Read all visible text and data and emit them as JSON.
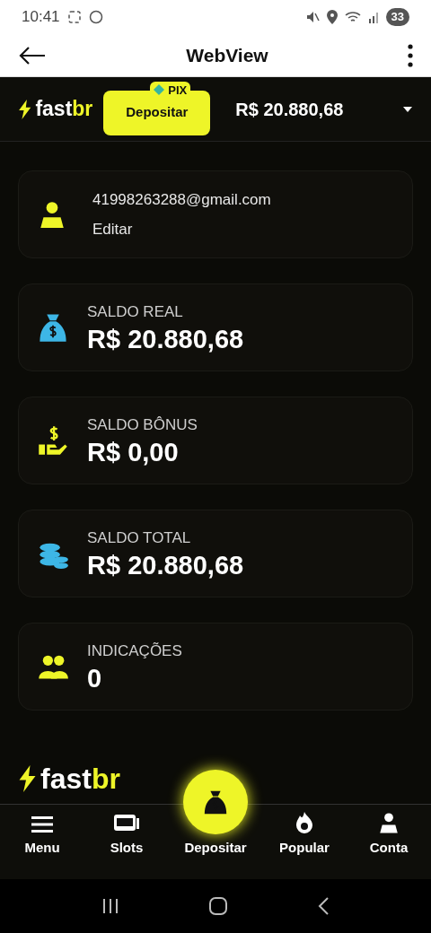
{
  "status_bar": {
    "time": "10:41",
    "battery": "33"
  },
  "app_bar": {
    "title": "WebView"
  },
  "header": {
    "logo": {
      "main": "fast",
      "accent": "br"
    },
    "deposit_button": "Depositar",
    "badge": "PIX",
    "balance": "R$ 20.880,68"
  },
  "cards": [
    {
      "kind": "profile",
      "email": "41998263288@gmail.com",
      "link": "Editar"
    },
    {
      "kind": "balance",
      "label": "SALDO REAL",
      "value": "R$ 20.880,68"
    },
    {
      "kind": "balance",
      "label": "SALDO BÔNUS",
      "value": "R$ 0,00"
    },
    {
      "kind": "balance",
      "label": "SALDO TOTAL",
      "value": "R$ 20.880,68"
    },
    {
      "kind": "balance",
      "label": "INDICAÇÕES",
      "value": "0"
    }
  ],
  "footer_logo": {
    "main": "fast",
    "accent": "br"
  },
  "bottom_nav": [
    {
      "kind": "tab",
      "label": "Menu"
    },
    {
      "kind": "tab",
      "label": "Slots"
    },
    {
      "kind": "fab",
      "label": "Depositar"
    },
    {
      "kind": "tab",
      "label": "Popular"
    },
    {
      "kind": "tab",
      "label": "Conta"
    }
  ]
}
